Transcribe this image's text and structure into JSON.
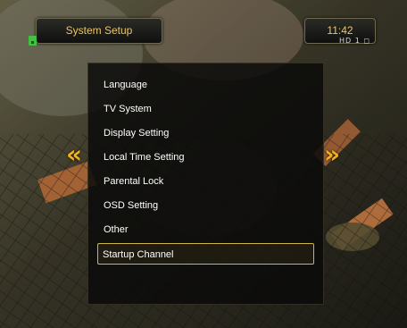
{
  "header": {
    "title": "System Setup",
    "time": "11:42",
    "status_icons": "HD 1 ◻"
  },
  "menu": {
    "items": [
      {
        "label": "Language"
      },
      {
        "label": "TV System"
      },
      {
        "label": "Display Setting"
      },
      {
        "label": "Local Time Setting"
      },
      {
        "label": "Parental Lock"
      },
      {
        "label": "OSD Setting"
      },
      {
        "label": "Other"
      },
      {
        "label": "Startup Channel",
        "selected": true
      }
    ]
  },
  "nav": {
    "left": "«",
    "right": "»"
  },
  "colors": {
    "accent": "#f0b21e",
    "selection_border": "#d1b449",
    "title_text": "#e9c56a"
  },
  "icons": [
    "tv-signal-icon",
    "hd-status-icon",
    "left-double-arrow-icon",
    "right-double-arrow-icon"
  ]
}
